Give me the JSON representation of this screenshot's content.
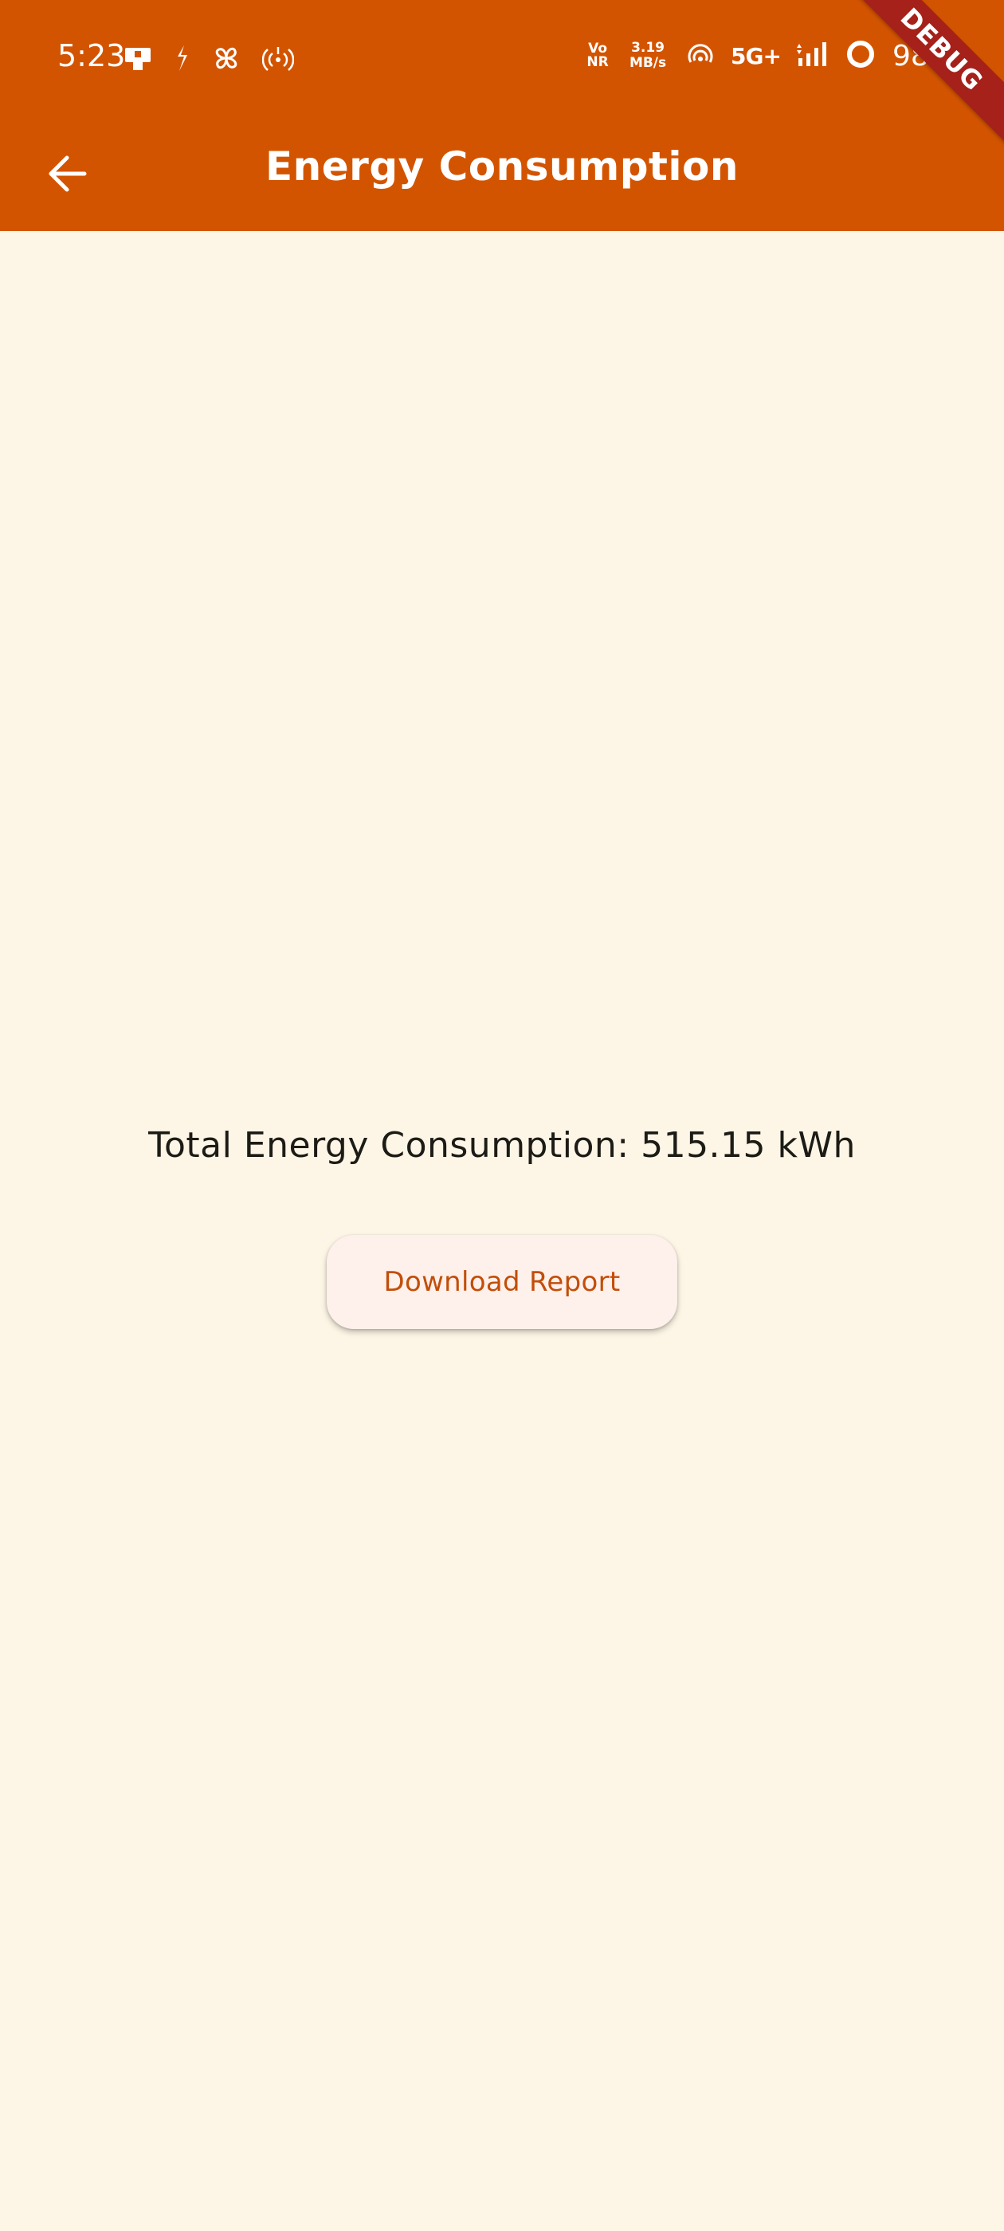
{
  "status_bar": {
    "time": "5:23",
    "left_icons": [
      "sim-card-icon",
      "kotak-icon",
      "pinwheel-icon",
      "hotspot-icon"
    ],
    "vonr_top": "Vo",
    "vonr_bottom": "NR",
    "net_speed_value": "3.19",
    "net_speed_unit": "MB/s",
    "network_type": "5G+",
    "battery_percent": "98%"
  },
  "app_bar": {
    "title": "Energy Consumption",
    "back_icon": "arrow-back-icon"
  },
  "debug_banner": "DEBUG",
  "main": {
    "total_energy_text": "Total Energy Consumption: 515.15 kWh",
    "download_button_label": "Download Report"
  },
  "colors": {
    "app_bar": "#D35400",
    "background": "#FDF6E6",
    "button_bg": "#FEF0EA",
    "button_text": "#C24E0A",
    "debug_banner": "#A5211A"
  }
}
